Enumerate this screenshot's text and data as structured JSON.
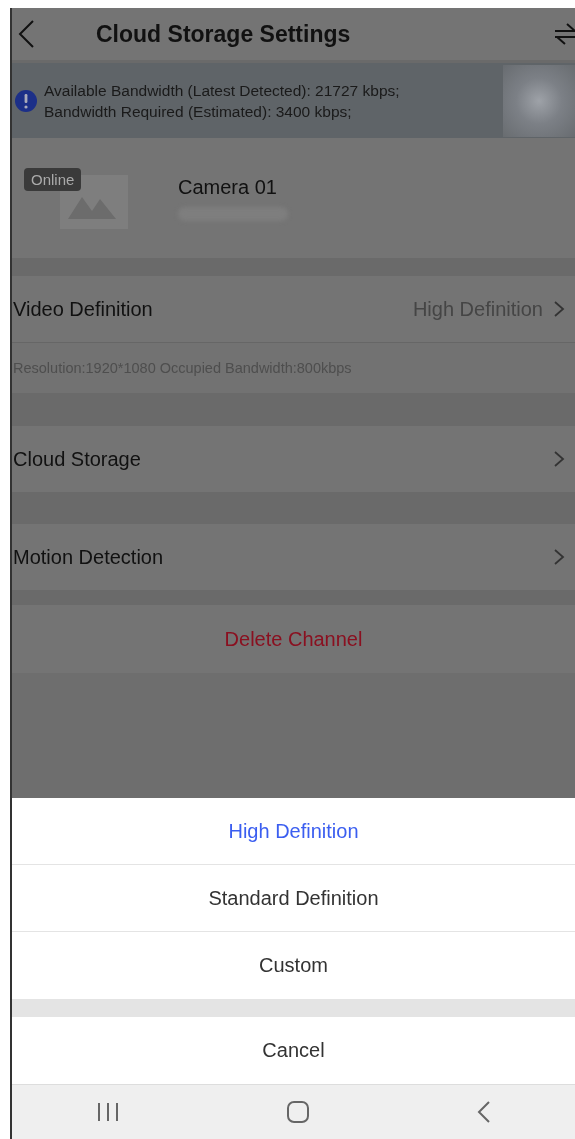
{
  "header": {
    "title": "Cloud Storage Settings"
  },
  "notice": {
    "lines": [
      "Available Bandwidth (Latest Detected): 21727 kbps;",
      "Bandwidth Required (Estimated): 3400 kbps;"
    ]
  },
  "camera": {
    "name": "Camera 01",
    "status": "Online"
  },
  "settings": [
    {
      "kind": "value",
      "label": "Video Definition",
      "value": "High Definition",
      "note": "Resolution:1920*1080 Occupied Bandwidth:800kbps"
    },
    {
      "kind": "link",
      "label": "Cloud Storage"
    },
    {
      "kind": "link",
      "label": "Motion Detection"
    }
  ],
  "delete_action": {
    "label": "Delete Channel"
  },
  "sheet": {
    "options": [
      {
        "label": "High Definition",
        "selected": true
      },
      {
        "label": "Standard Definition",
        "selected": false
      },
      {
        "label": "Custom",
        "selected": false
      }
    ],
    "cancel": "Cancel"
  }
}
